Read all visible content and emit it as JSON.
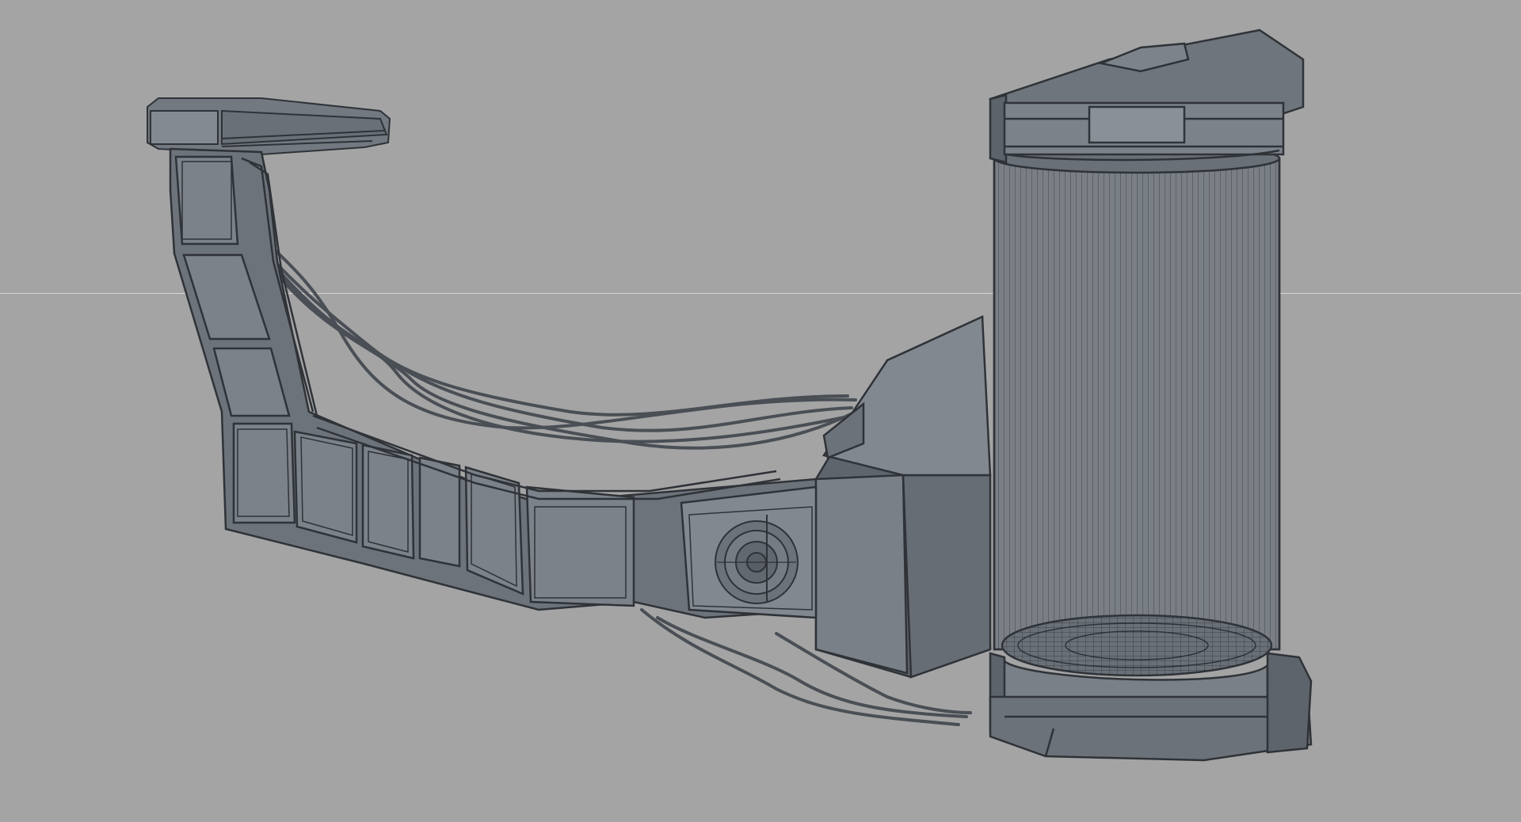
{
  "viewport": {
    "background_color": "#a4a4a4",
    "horizon_line_color": "#d6d6d6",
    "shading": "wireframe-on-shaded"
  },
  "model": {
    "mesh_fill": "#727880",
    "mesh_fill_dark": "#5d636b",
    "mesh_fill_light": "#8a9098",
    "wire_color": "#2f3338",
    "cable_color": "#4a4f56",
    "parts": [
      "arm-crossbar",
      "arm-segments",
      "junction-housing",
      "cylinder-tank",
      "tank-cap-top",
      "tank-base",
      "cables",
      "dial"
    ]
  }
}
